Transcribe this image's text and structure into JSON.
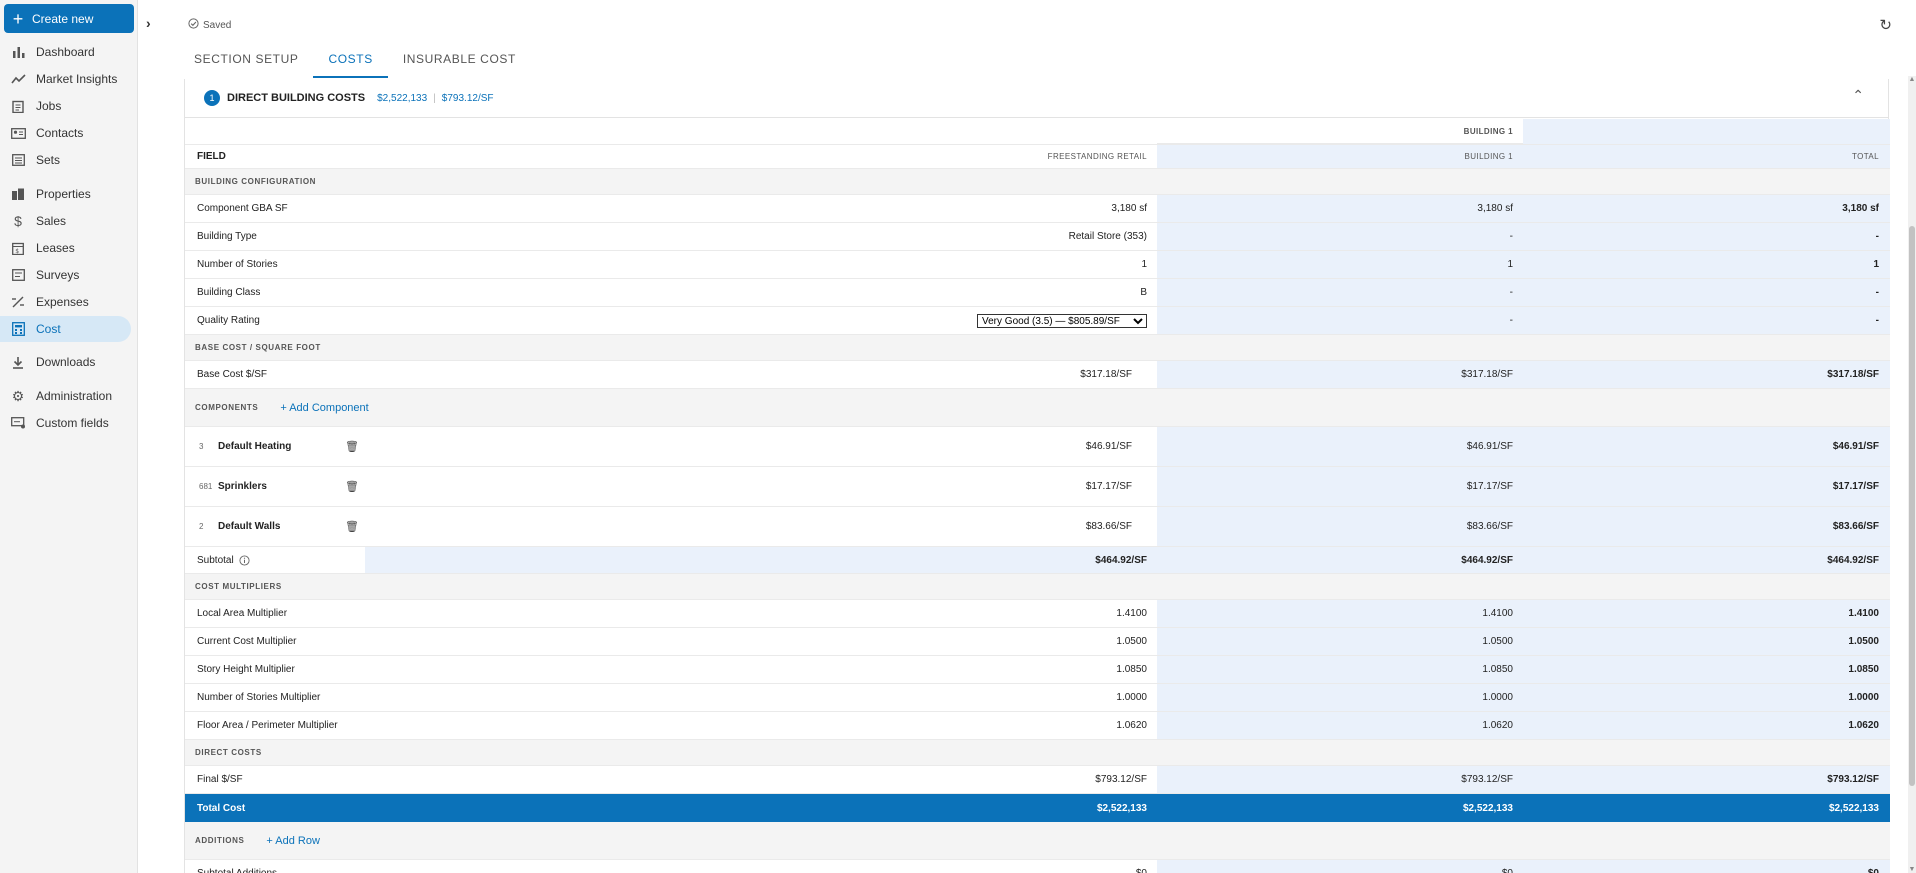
{
  "sidebar": {
    "create_label": "Create new",
    "items": [
      {
        "label": "Dashboard",
        "icon": "bar-chart-icon"
      },
      {
        "label": "Market Insights",
        "icon": "trend-line-icon"
      },
      {
        "label": "Jobs",
        "icon": "clipboard-icon"
      },
      {
        "label": "Contacts",
        "icon": "contact-card-icon"
      },
      {
        "label": "Sets",
        "icon": "list-icon"
      },
      {
        "label": "Properties",
        "icon": "buildings-icon"
      },
      {
        "label": "Sales",
        "icon": "dollar-icon"
      },
      {
        "label": "Leases",
        "icon": "lease-icon"
      },
      {
        "label": "Surveys",
        "icon": "survey-icon"
      },
      {
        "label": "Expenses",
        "icon": "percent-icon"
      },
      {
        "label": "Cost",
        "icon": "calculator-icon"
      },
      {
        "label": "Downloads",
        "icon": "download-icon"
      },
      {
        "label": "Administration",
        "icon": "gear-icon"
      },
      {
        "label": "Custom fields",
        "icon": "custom-fields-icon"
      }
    ],
    "active": "Cost"
  },
  "status": {
    "saved": "Saved"
  },
  "tabs": [
    "SECTION SETUP",
    "COSTS",
    "INSURABLE COST"
  ],
  "active_tab": "COSTS",
  "section": {
    "number": "1",
    "title": "DIRECT BUILDING COSTS",
    "total": "$2,522,133",
    "per_sf": "$793.12/SF"
  },
  "table": {
    "building_group": "BUILDING 1",
    "headers": {
      "field": "FIELD",
      "a": "FREESTANDING RETAIL",
      "b": "BUILDING 1",
      "total": "TOTAL"
    },
    "building_configuration": {
      "title": "BUILDING CONFIGURATION",
      "rows": [
        {
          "field": "Component GBA SF",
          "a": "3,180 sf",
          "b": "3,180 sf",
          "t": "3,180 sf"
        },
        {
          "field": "Building Type",
          "a": "Retail Store (353)",
          "b": "-",
          "t": "-"
        },
        {
          "field": "Number of Stories",
          "a": "1",
          "b": "1",
          "t": "1"
        },
        {
          "field": "Building Class",
          "a": "B",
          "b": "-",
          "t": "-"
        }
      ],
      "quality": {
        "field": "Quality Rating",
        "selected": "Very Good (3.5) — $805.89/SF",
        "b": "-",
        "t": "-"
      }
    },
    "base_cost": {
      "title": "BASE COST / SQUARE FOOT",
      "row": {
        "field": "Base Cost $/SF",
        "a": "$317.18/SF",
        "b": "$317.18/SF",
        "t": "$317.18/SF"
      }
    },
    "components": {
      "title": "COMPONENTS",
      "add_label": "+ Add Component",
      "rows": [
        {
          "code": "3",
          "name": "Default Heating",
          "a": "$46.91/SF",
          "b": "$46.91/SF",
          "t": "$46.91/SF"
        },
        {
          "code": "681",
          "name": "Sprinklers",
          "a": "$17.17/SF",
          "b": "$17.17/SF",
          "t": "$17.17/SF"
        },
        {
          "code": "2",
          "name": "Default Walls",
          "a": "$83.66/SF",
          "b": "$83.66/SF",
          "t": "$83.66/SF"
        }
      ],
      "subtotal": {
        "field": "Subtotal",
        "a": "$464.92/SF",
        "b": "$464.92/SF",
        "t": "$464.92/SF"
      }
    },
    "cost_multipliers": {
      "title": "COST MULTIPLIERS",
      "rows": [
        {
          "field": "Local Area Multiplier",
          "a": "1.4100",
          "b": "1.4100",
          "t": "1.4100"
        },
        {
          "field": "Current Cost Multiplier",
          "a": "1.0500",
          "b": "1.0500",
          "t": "1.0500"
        },
        {
          "field": "Story Height Multiplier",
          "a": "1.0850",
          "b": "1.0850",
          "t": "1.0850"
        },
        {
          "field": "Number of Stories Multiplier",
          "a": "1.0000",
          "b": "1.0000",
          "t": "1.0000"
        },
        {
          "field": "Floor Area / Perimeter Multiplier",
          "a": "1.0620",
          "b": "1.0620",
          "t": "1.0620"
        }
      ]
    },
    "direct_costs": {
      "title": "DIRECT COSTS",
      "final": {
        "field": "Final $/SF",
        "a": "$793.12/SF",
        "b": "$793.12/SF",
        "t": "$793.12/SF"
      },
      "total": {
        "field": "Total Cost",
        "a": "$2,522,133",
        "b": "$2,522,133",
        "t": "$2,522,133"
      }
    },
    "additions": {
      "title": "ADDITIONS",
      "add_label": "+ Add Row",
      "subtotal": {
        "field": "Subtotal Additions",
        "a": "$0",
        "b": "$0",
        "t": "$0"
      }
    }
  },
  "colors": {
    "accent": "#0b72b9",
    "building_col_bg": "#eaf1fb"
  }
}
